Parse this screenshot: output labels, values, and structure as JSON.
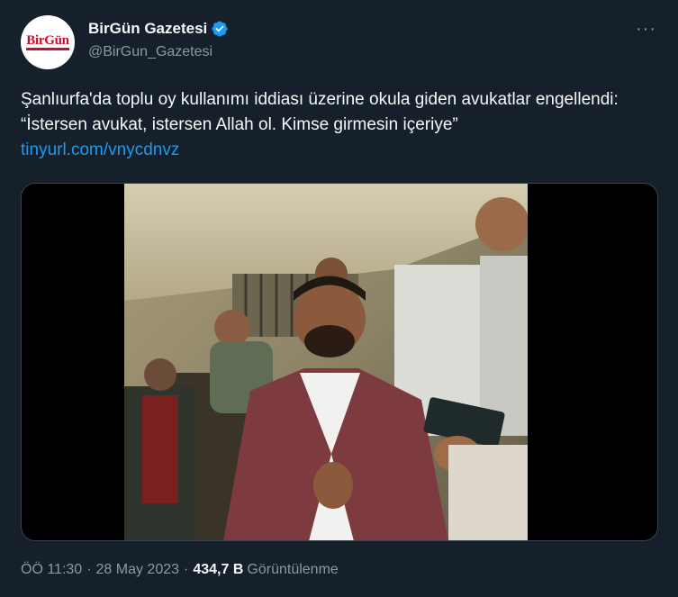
{
  "account": {
    "display_name": "BirGün Gazetesi",
    "handle": "@BirGun_Gazetesi",
    "avatar_logo": "BirGün",
    "verified_icon": "verified-badge-icon",
    "more_icon": "more-options-icon",
    "more_glyph": "···"
  },
  "tweet": {
    "text": "Şanlıurfa'da toplu oy kullanımı iddiası üzerine okula giden avukatlar engellendi: “İstersen avukat, istersen Allah ol. Kimse girmesin içeriye”",
    "link": "tinyurl.com/vnycdnvz"
  },
  "media": {
    "type": "video",
    "icon": "video-thumbnail"
  },
  "meta": {
    "time": "ÖÖ 11:30",
    "separator": "·",
    "date": "28 May 2023",
    "views_count": "434,7 B",
    "views_label": "Görüntülenme"
  },
  "colors": {
    "background": "#15202b",
    "text": "#f7f9f9",
    "secondary": "#8b98a5",
    "link": "#1d9bf0",
    "border": "#38444d",
    "brand": "#c8102e"
  }
}
